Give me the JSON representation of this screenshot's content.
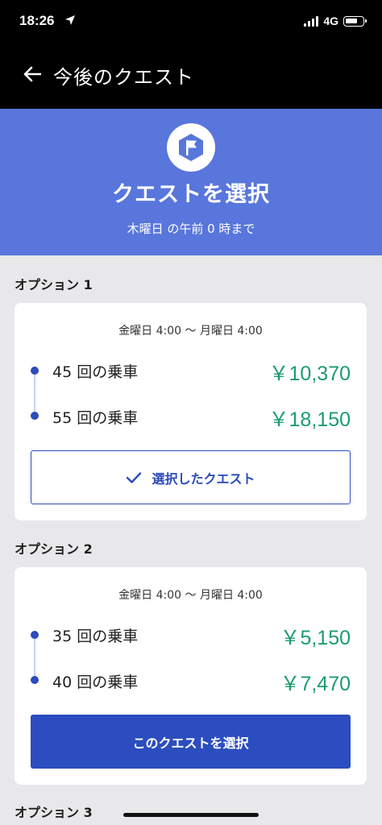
{
  "status": {
    "time": "18:26",
    "network": "4G"
  },
  "nav": {
    "title": "今後のクエスト"
  },
  "hero": {
    "title": "クエストを選択",
    "subtitle": "木曜日 の午前 0 時まで",
    "icon": "flag-icon",
    "background": "#5876db"
  },
  "options": [
    {
      "label": "オプション 1",
      "period": "金曜日 4:00 〜 月曜日 4:00",
      "tiers": [
        {
          "rides": "45 回の乗車",
          "amount": "￥10,370"
        },
        {
          "rides": "55 回の乗車",
          "amount": "￥18,150"
        }
      ],
      "button": "選択したクエスト",
      "selected": true
    },
    {
      "label": "オプション 2",
      "period": "金曜日 4:00 〜 月曜日 4:00",
      "tiers": [
        {
          "rides": "35 回の乗車",
          "amount": "￥5,150"
        },
        {
          "rides": "40 回の乗車",
          "amount": "￥7,470"
        }
      ],
      "button": "このクエストを選択",
      "selected": false
    },
    {
      "label": "オプション 3"
    }
  ],
  "colors": {
    "accent": "#2b4dbf",
    "amount": "#1a9b73"
  }
}
